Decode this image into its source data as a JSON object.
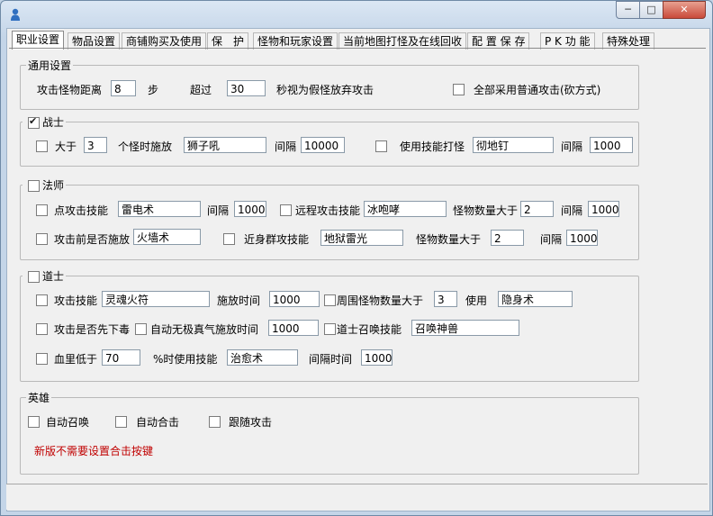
{
  "tabs": [
    "职业设置",
    "物品设置",
    "商铺购买及使用",
    "保　护",
    "怪物和玩家设置",
    "当前地图打怪及在线回收",
    "配 置 保 存",
    "P K 功 能",
    "特殊处理"
  ],
  "general": {
    "title": "通用设置",
    "attack_distance_label": "攻击怪物距离",
    "attack_distance_value": "8",
    "steps_label": "步",
    "over_label": "超过",
    "over_value": "30",
    "seconds_label": "秒视为假怪放弃攻击",
    "all_normal_label": "全部采用普通攻击(砍方式)"
  },
  "warrior": {
    "title": "战士",
    "gt_label": "大于",
    "gt_value": "3",
    "monsters_cast_label": "个怪时施放",
    "skill1_value": "狮子吼",
    "interval_label": "间隔",
    "interval1_value": "10000",
    "use_skill_label": "使用技能打怪",
    "skill2_value": "彻地钉",
    "interval2_label": "间隔",
    "interval2_value": "1000"
  },
  "mage": {
    "title": "法师",
    "point_attack_label": "点攻击技能",
    "point_skill_value": "雷电术",
    "interval_label": "间隔",
    "point_interval_value": "1000",
    "remote_attack_label": "远程攻击技能",
    "remote_skill_value": "冰咆哮",
    "monster_count_label": "怪物数量大于",
    "remote_count_value": "2",
    "remote_interval_label": "间隔",
    "remote_interval_value": "1000",
    "before_attack_label": "攻击前是否施放",
    "before_skill_value": "火墙术",
    "melee_label": "近身群攻技能",
    "melee_skill_value": "地狱雷光",
    "melee_count_label": "怪物数量大于",
    "melee_count_value": "2",
    "melee_interval_label": "间隔",
    "melee_interval_value": "1000"
  },
  "taoist": {
    "title": "道士",
    "attack_skill_label": "攻击技能",
    "attack_skill_value": "灵魂火符",
    "cast_time_label": "施放时间",
    "cast_time_value": "1000",
    "around_count_label": "周围怪物数量大于",
    "around_count_value": "3",
    "use_label": "使用",
    "use_skill_value": "隐身术",
    "poison_first_label": "攻击是否先下毒",
    "auto_shield_label": "自动无极真气施放时间",
    "auto_shield_value": "1000",
    "summon_label": "道士召唤技能",
    "summon_value": "召唤神兽",
    "hp_low_label": "血里低于",
    "hp_low_value": "70",
    "hp_skill_label": "%时使用技能",
    "hp_skill_value": "治愈术",
    "interval_time_label": "间隔时间",
    "interval_time_value": "1000"
  },
  "hero": {
    "title": "英雄",
    "auto_summon_label": "自动召唤",
    "auto_combo_label": "自动合击",
    "follow_attack_label": "跟随攻击",
    "note": "新版不需要设置合击按键"
  },
  "window_buttons": {
    "minimize": "─",
    "maximize": "□",
    "close": "✕"
  },
  "colors": {
    "note": "#c00000",
    "close_button": "#c94a3a"
  }
}
